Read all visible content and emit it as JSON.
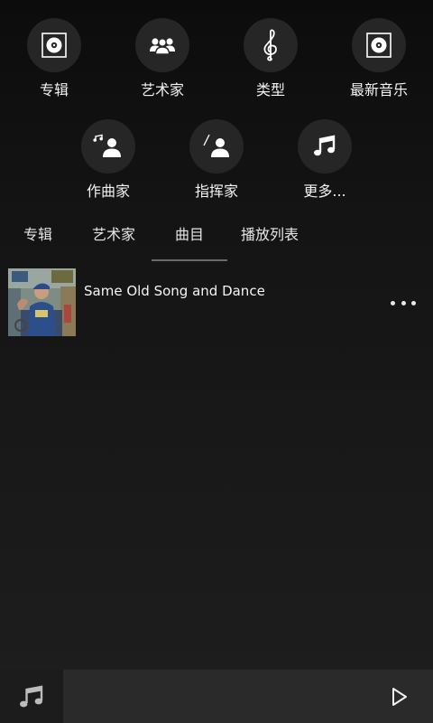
{
  "categories_row1": [
    {
      "label": "专辑",
      "icon": "album-icon"
    },
    {
      "label": "艺术家",
      "icon": "artists-icon"
    },
    {
      "label": "类型",
      "icon": "treble-clef-icon"
    },
    {
      "label": "最新音乐",
      "icon": "recent-album-icon"
    }
  ],
  "categories_row2": [
    {
      "label": "作曲家",
      "icon": "composer-icon"
    },
    {
      "label": "指挥家",
      "icon": "conductor-icon"
    },
    {
      "label": "更多...",
      "icon": "music-note-icon"
    }
  ],
  "tabs": [
    {
      "label": "专辑"
    },
    {
      "label": "艺术家"
    },
    {
      "label": "曲目",
      "selected": true
    },
    {
      "label": "播放列表"
    }
  ],
  "tracks": [
    {
      "title": "Same Old Song and Dance"
    }
  ],
  "colors": {
    "background": "#141414",
    "circle": "#262626",
    "bottom_bar": "#2a2a2a"
  }
}
